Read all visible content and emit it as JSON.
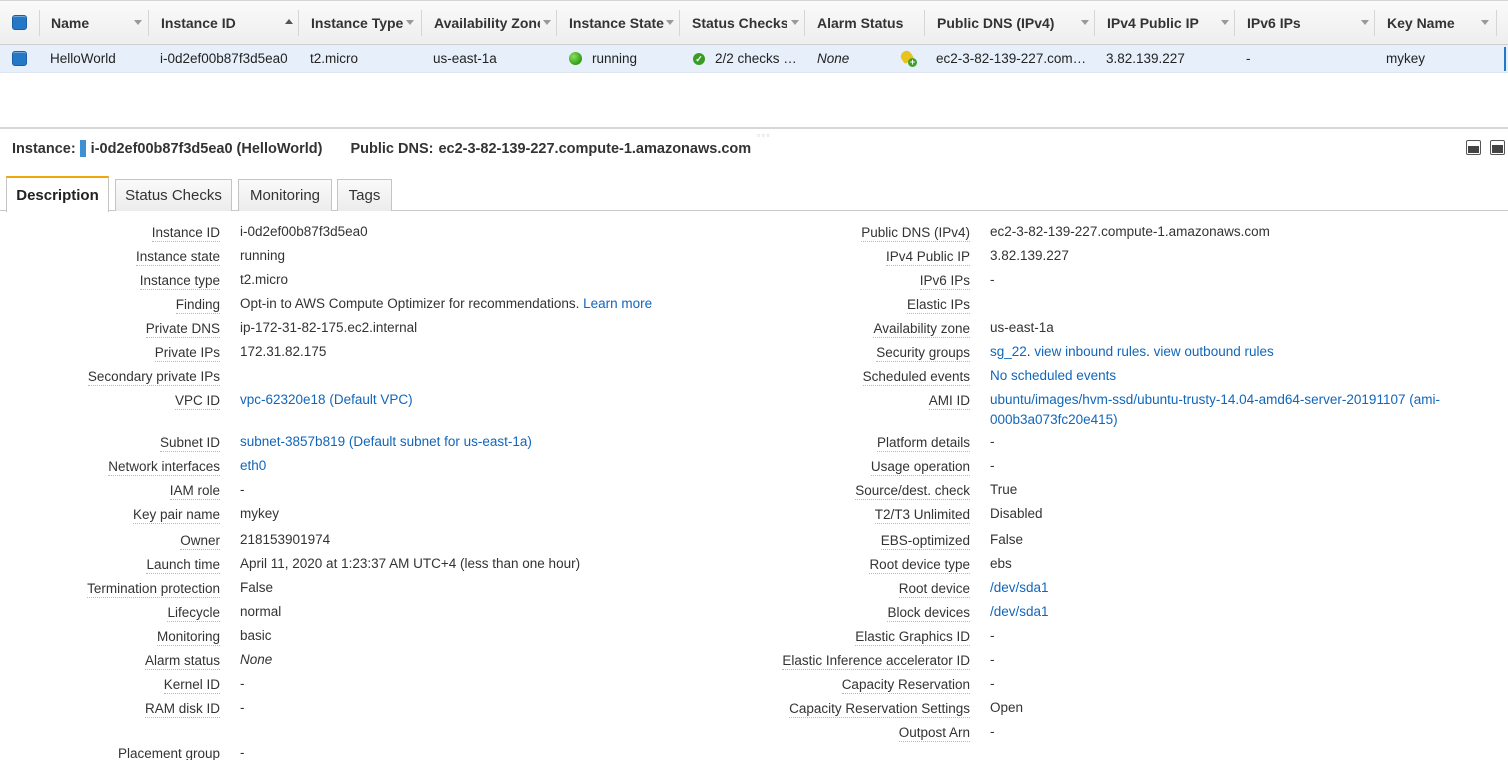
{
  "table": {
    "columns": [
      {
        "label": "Name"
      },
      {
        "label": "Instance ID"
      },
      {
        "label": "Instance Type"
      },
      {
        "label": "Availability Zone"
      },
      {
        "label": "Instance State"
      },
      {
        "label": "Status Checks"
      },
      {
        "label": "Alarm Status"
      },
      {
        "label": "Public DNS (IPv4)"
      },
      {
        "label": "IPv4 Public IP"
      },
      {
        "label": "IPv6 IPs"
      },
      {
        "label": "Key Name"
      }
    ],
    "row": {
      "name": "HelloWorld",
      "instance_id": "i-0d2ef00b87f3d5ea0",
      "instance_type": "t2.micro",
      "availability_zone": "us-east-1a",
      "instance_state": "running",
      "status_checks": "2/2 checks …",
      "alarm_status": "None",
      "public_dns": "ec2-3-82-139-227.com…",
      "ipv4_public_ip": "3.82.139.227",
      "ipv6_ips": "-",
      "key_name": "mykey"
    }
  },
  "detail": {
    "instance_label": "Instance:",
    "instance_value": "i-0d2ef00b87f3d5ea0 (HelloWorld)",
    "dns_label": "Public DNS:",
    "dns_value": "ec2-3-82-139-227.compute-1.amazonaws.com"
  },
  "tabs": [
    "Description",
    "Status Checks",
    "Monitoring",
    "Tags"
  ],
  "description": {
    "left": [
      {
        "label": "Instance ID",
        "value": "i-0d2ef00b87f3d5ea0"
      },
      {
        "label": "Instance state",
        "value": "running"
      },
      {
        "label": "Instance type",
        "value": "t2.micro"
      },
      {
        "label": "Finding",
        "value": "Opt-in to AWS Compute Optimizer for recommendations.",
        "link": "Learn more"
      },
      {
        "label": "Private DNS",
        "value": "ip-172-31-82-175.ec2.internal"
      },
      {
        "label": "Private IPs",
        "value": "172.31.82.175"
      },
      {
        "label": "Secondary private IPs",
        "value": ""
      },
      {
        "label": "VPC ID",
        "value": "vpc-62320e18 (Default VPC)"
      },
      {
        "label": "Subnet ID",
        "value": "subnet-3857b819 (Default subnet for us-east-1a)"
      },
      {
        "label": "Network interfaces",
        "value": "eth0"
      },
      {
        "label": "IAM role",
        "value": "-"
      },
      {
        "label": "Key pair name",
        "value": "mykey"
      },
      {
        "label": "Owner",
        "value": "218153901974"
      },
      {
        "label": "Launch time",
        "value": "April 11, 2020 at 1:23:37 AM UTC+4 (less than one hour)"
      },
      {
        "label": "Termination protection",
        "value": "False"
      },
      {
        "label": "Lifecycle",
        "value": "normal"
      },
      {
        "label": "Monitoring",
        "value": "basic"
      },
      {
        "label": "Alarm status",
        "value": "None"
      },
      {
        "label": "Kernel ID",
        "value": "-"
      },
      {
        "label": "RAM disk ID",
        "value": "-"
      },
      {
        "label": "Placement group",
        "value": "-"
      }
    ],
    "right": [
      {
        "label": "Public DNS (IPv4)",
        "value": "ec2-3-82-139-227.compute-1.amazonaws.com"
      },
      {
        "label": "IPv4 Public IP",
        "value": "3.82.139.227"
      },
      {
        "label": "IPv6 IPs",
        "value": "-"
      },
      {
        "label": "Elastic IPs",
        "value": ""
      },
      {
        "label": "Availability zone",
        "value": "us-east-1a"
      },
      {
        "label": "Security groups",
        "value": "sg_22",
        "link1": "view inbound rules",
        "link2": "view outbound rules"
      },
      {
        "label": "Scheduled events",
        "value": "No scheduled events"
      },
      {
        "label": "AMI ID",
        "value": "ubuntu/images/hvm-ssd/ubuntu-trusty-14.04-amd64-server-20191107 (ami-",
        "value2": "000b3a073fc20e415)"
      },
      {
        "label": "Platform details",
        "value": "-"
      },
      {
        "label": "Usage operation",
        "value": "-"
      },
      {
        "label": "Source/dest. check",
        "value": "True"
      },
      {
        "label": "T2/T3 Unlimited",
        "value": "Disabled"
      },
      {
        "label": "EBS-optimized",
        "value": "False"
      },
      {
        "label": "Root device type",
        "value": "ebs"
      },
      {
        "label": "Root device",
        "value": "/dev/sda1"
      },
      {
        "label": "Block devices",
        "value": "/dev/sda1"
      },
      {
        "label": "Elastic Graphics ID",
        "value": "-"
      },
      {
        "label": "Elastic Inference accelerator ID",
        "value": "-"
      },
      {
        "label": "Capacity Reservation",
        "value": "-"
      },
      {
        "label": "Capacity Reservation Settings",
        "value": "Open"
      },
      {
        "label": "Outpost Arn",
        "value": "-"
      }
    ]
  },
  "colors": {
    "accent": "#2478c6",
    "link": "#1166bb",
    "tab_highlight": "#f0a70e",
    "selected_row": "#e7f0fa",
    "running": "#2f9d14"
  }
}
